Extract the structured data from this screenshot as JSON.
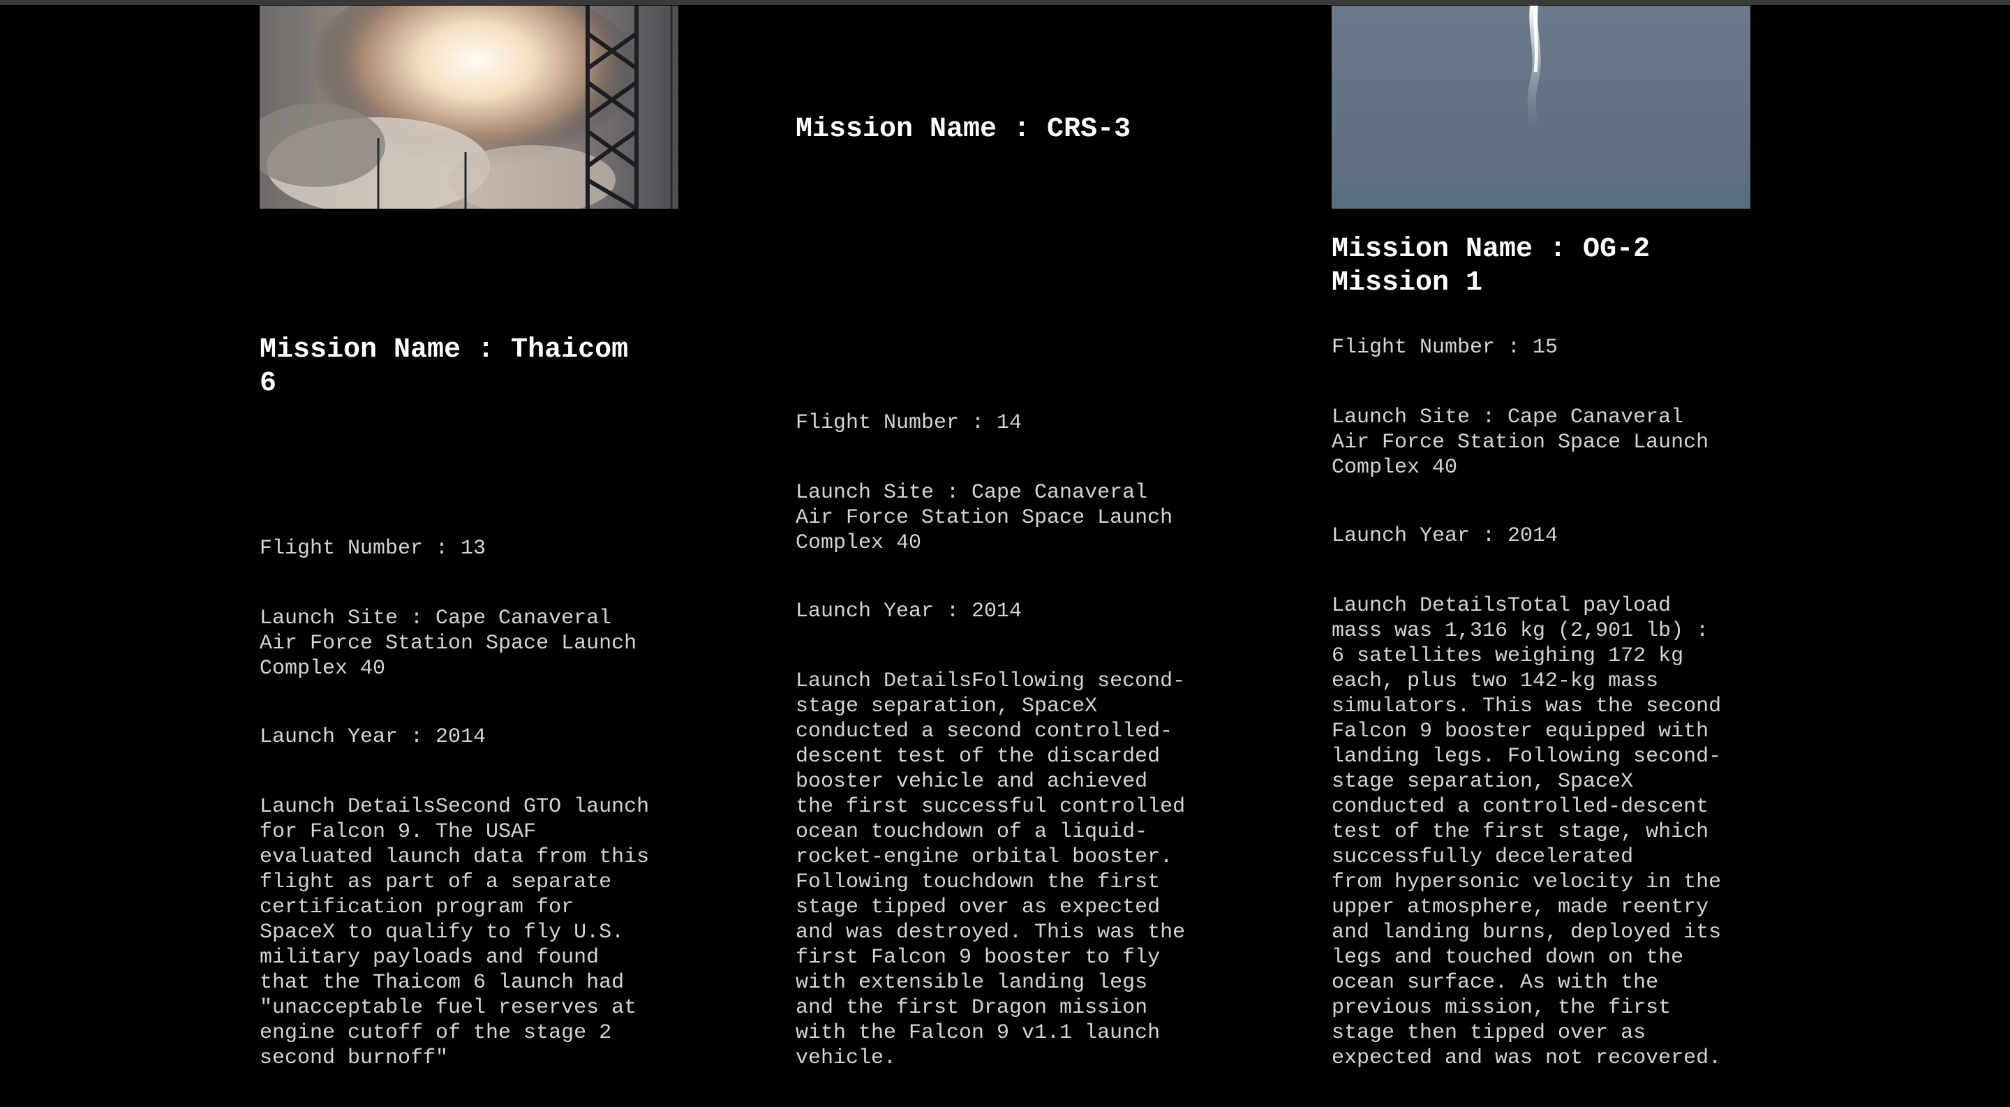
{
  "launches": [
    {
      "image_alt": "rocket launch smoke plume at launch pad",
      "mission_title": "Mission Name : Thaicom\n6",
      "flight_number": "Flight Number : 13",
      "launch_site": "Launch Site : Cape Canaveral\nAir Force Station Space Launch\nComplex 40",
      "launch_year": "Launch Year : 2014",
      "launch_details": "Launch DetailsSecond GTO launch\nfor Falcon 9. The USAF\nevaluated launch data from this\nflight as part of a separate\ncertification program for\nSpaceX to qualify to fly U.S.\nmilitary payloads and found\nthat the Thaicom 6 launch had\n\"unacceptable fuel reserves at\nengine cutoff of the stage 2\nsecond burnoff\""
    },
    {
      "mission_title": "Mission Name : CRS-3",
      "flight_number": "Flight Number : 14",
      "launch_site": "Launch Site : Cape Canaveral\nAir Force Station Space Launch\nComplex 40",
      "launch_year": "Launch Year : 2014",
      "launch_details": "Launch DetailsFollowing second-\nstage separation, SpaceX\nconducted a second controlled-\ndescent test of the discarded\nbooster vehicle and achieved\nthe first successful controlled\nocean touchdown of a liquid-\nrocket-engine orbital booster.\nFollowing touchdown the first\nstage tipped over as expected\nand was destroyed. This was the\nfirst Falcon 9 booster to fly\nwith extensible landing legs\nand the first Dragon mission\nwith the Falcon 9 v1.1 launch\nvehicle."
    },
    {
      "image_alt": "rocket exhaust trail against sky",
      "mission_title": "Mission Name : OG-2\nMission 1",
      "flight_number": "Flight Number : 15",
      "launch_site": "Launch Site : Cape Canaveral\nAir Force Station Space Launch\nComplex 40",
      "launch_year": "Launch Year : 2014",
      "launch_details": "Launch DetailsTotal payload\nmass was 1,316 kg (2,901 lb) :\n6 satellites weighing 172 kg\neach, plus two 142-kg mass\nsimulators. This was the second\nFalcon 9 booster equipped with\nlanding legs. Following second-\nstage separation, SpaceX\nconducted a controlled-descent\ntest of the first stage, which\nsuccessfully decelerated\nfrom hypersonic velocity in the\nupper atmosphere, made reentry\nand landing burns, deployed its\nlegs and touched down on the\nocean surface. As with the\nprevious mission, the first\nstage then tipped over as\nexpected and was not recovered."
    }
  ]
}
